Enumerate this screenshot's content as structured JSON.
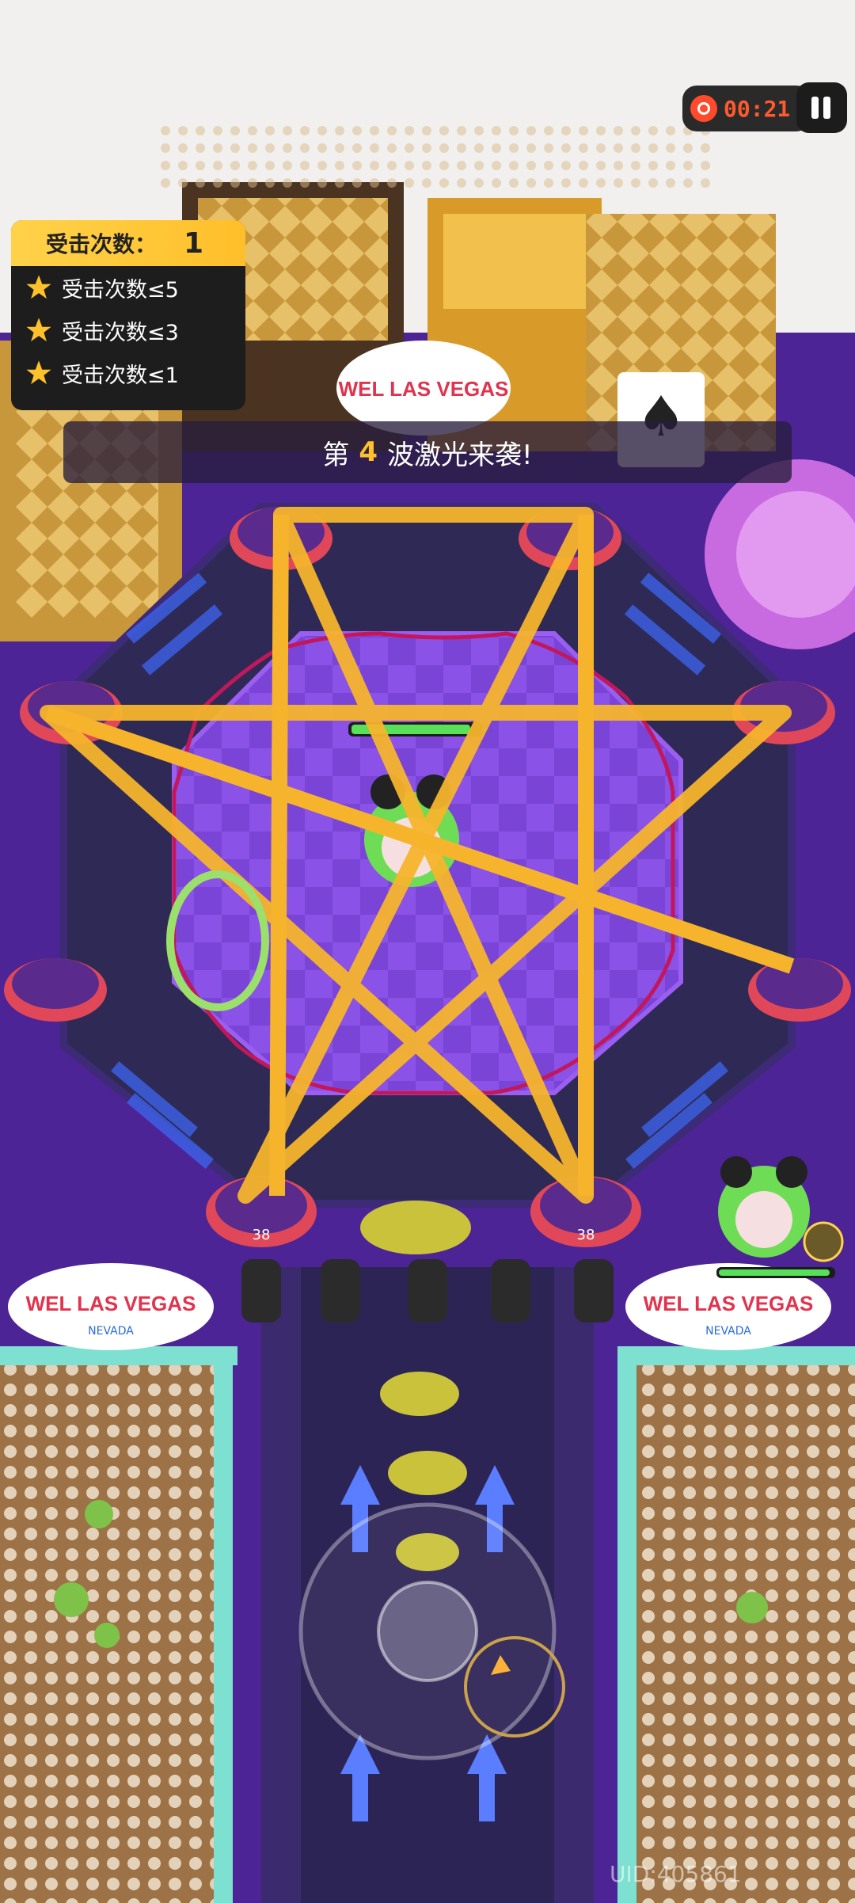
{
  "hud": {
    "timer": "00:21",
    "pause_icon": "pause-icon",
    "hit_panel": {
      "label": "受击次数：",
      "count": "1",
      "goals": [
        "受击次数≤5",
        "受击次数≤3",
        "受击次数≤1"
      ]
    },
    "wave_banner": {
      "prefix": "第",
      "number": "4",
      "suffix": "波激光来袭!"
    },
    "uid": "UID:405861"
  },
  "signs": {
    "top": "WEL LAS VEGAS",
    "left": "WEL LAS VEGAS",
    "right": "WEL LAS VEGAS",
    "nevada": "NEVADA"
  },
  "pads": {
    "label": "38"
  },
  "colors": {
    "floor": "#5a2fa8",
    "laser": "#f6b42c",
    "safe_ring": "#9be06a",
    "panel_bg": "#1d1d1d",
    "panel_header": "#ffc72a",
    "timer": "#ff5a2e"
  }
}
